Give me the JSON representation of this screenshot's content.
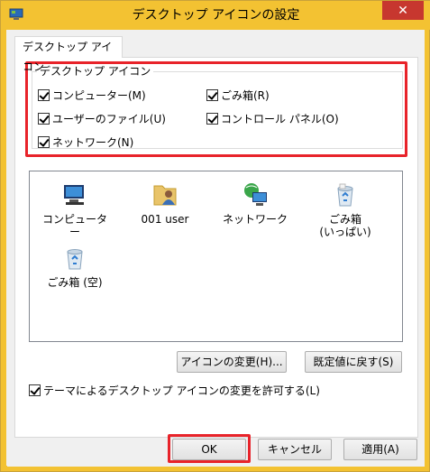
{
  "window": {
    "title": "デスクトップ アイコンの設定",
    "close_glyph": "✕"
  },
  "tab": {
    "label": "デスクトップ アイコン"
  },
  "group": {
    "legend": "デスクトップ アイコン",
    "checkboxes": [
      {
        "label": "コンピューター(M)",
        "checked": true
      },
      {
        "label": "ごみ箱(R)",
        "checked": true
      },
      {
        "label": "ユーザーのファイル(U)",
        "checked": true
      },
      {
        "label": "コントロール パネル(O)",
        "checked": true
      },
      {
        "label": "ネットワーク(N)",
        "checked": true
      }
    ]
  },
  "icons": [
    {
      "label": "コンピューター",
      "icon": "computer-icon"
    },
    {
      "label": "001 user",
      "icon": "user-folder-icon"
    },
    {
      "label": "ネットワーク",
      "icon": "network-icon"
    },
    {
      "label": "ごみ箱",
      "label2": "(いっぱい)",
      "icon": "recycle-bin-full-icon"
    },
    {
      "label": "ごみ箱 (空)",
      "icon": "recycle-bin-empty-icon"
    }
  ],
  "buttons": {
    "change_icon": "アイコンの変更(H)...",
    "restore_default": "既定値に戻す(S)",
    "ok": "OK",
    "cancel": "キャンセル",
    "apply": "適用(A)"
  },
  "theme_checkbox": {
    "label": "テーマによるデスクトップ アイコンの変更を許可する(L)",
    "checked": true
  },
  "colors": {
    "titlebar": "#f3c232",
    "close": "#c7372f",
    "highlight": "#e8232a"
  }
}
